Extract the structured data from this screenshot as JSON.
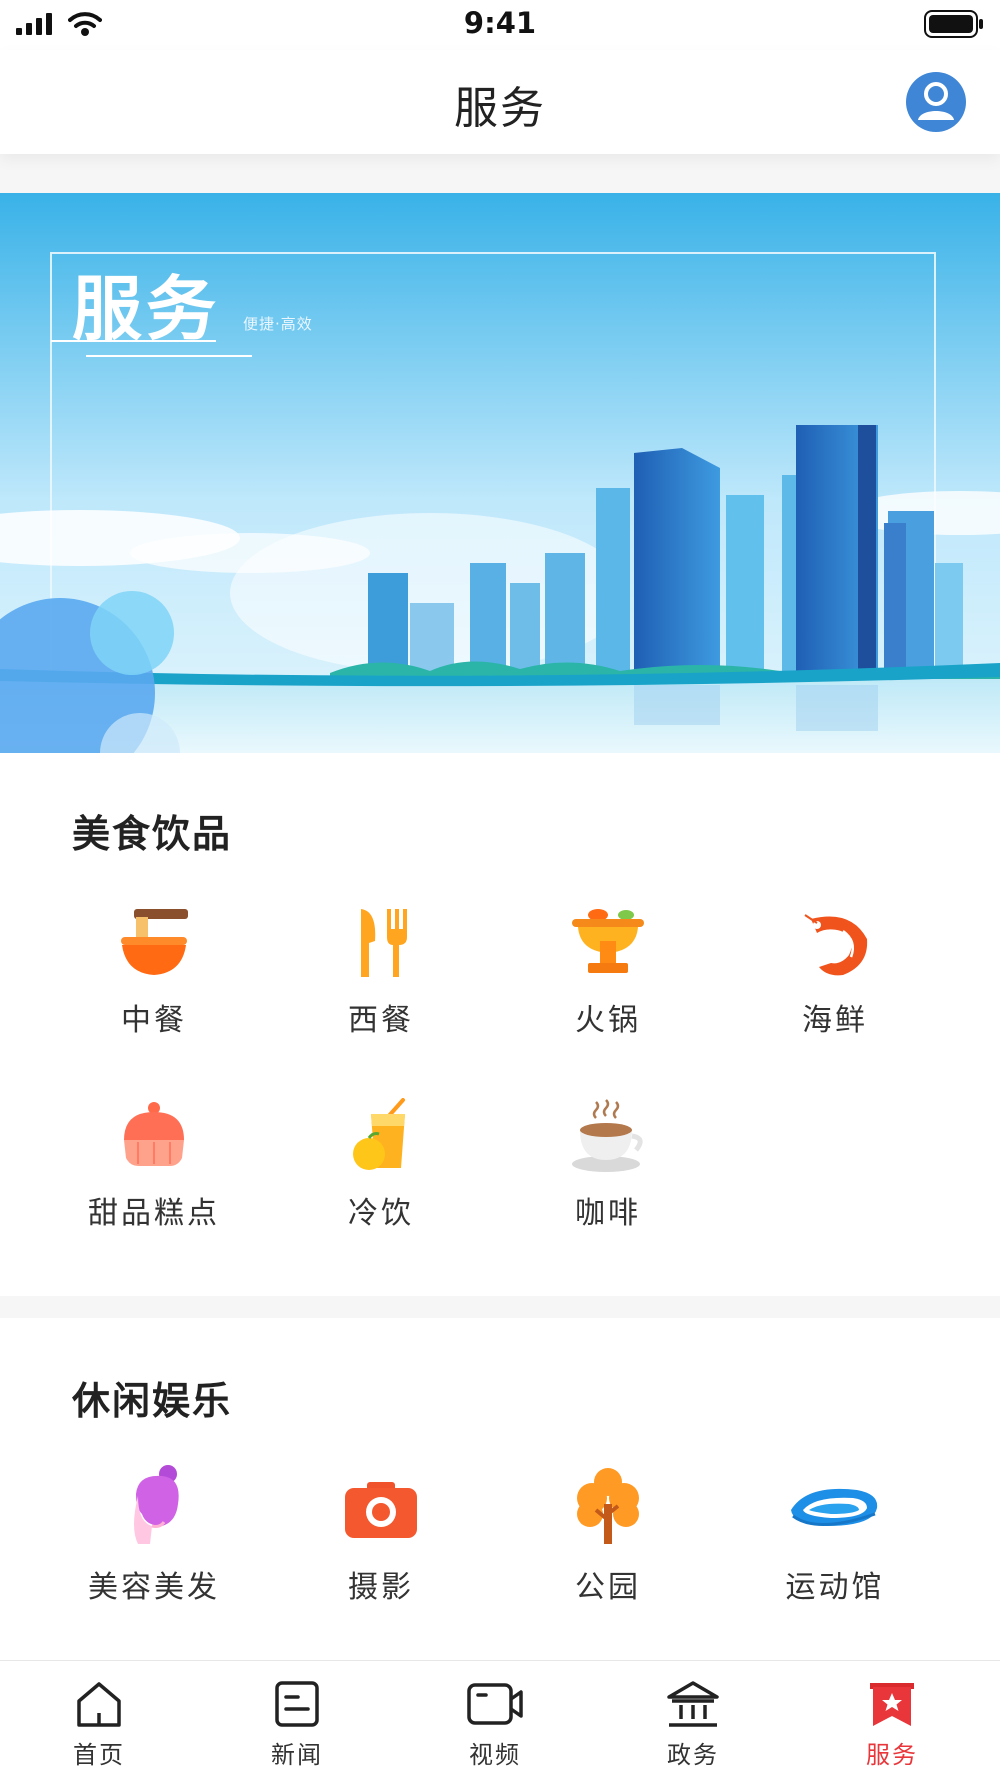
{
  "status_bar": {
    "time": "9:41"
  },
  "header": {
    "title": "服务"
  },
  "banner": {
    "title": "服务",
    "subtitle": "便捷·高效"
  },
  "sections": [
    {
      "title": "美食饮品",
      "items": [
        {
          "label": "中餐",
          "icon": "noodle-bowl-icon"
        },
        {
          "label": "西餐",
          "icon": "fork-knife-icon"
        },
        {
          "label": "火锅",
          "icon": "hotpot-icon"
        },
        {
          "label": "海鲜",
          "icon": "shrimp-icon"
        },
        {
          "label": "甜品糕点",
          "icon": "cake-icon"
        },
        {
          "label": "冷饮",
          "icon": "juice-icon"
        },
        {
          "label": "咖啡",
          "icon": "coffee-cup-icon"
        }
      ]
    },
    {
      "title": "休闲娱乐",
      "items": [
        {
          "label": "美容美发",
          "icon": "hair-salon-icon"
        },
        {
          "label": "摄影",
          "icon": "camera-icon"
        },
        {
          "label": "公园",
          "icon": "tree-icon"
        },
        {
          "label": "运动馆",
          "icon": "stadium-icon"
        }
      ]
    }
  ],
  "tabbar": {
    "active": "服务",
    "active_color": "#e8363a",
    "tabs": [
      {
        "label": "首页",
        "icon": "home-icon"
      },
      {
        "label": "新闻",
        "icon": "news-icon"
      },
      {
        "label": "视频",
        "icon": "video-camera-icon"
      },
      {
        "label": "政务",
        "icon": "government-building-icon"
      },
      {
        "label": "服务",
        "icon": "service-bookmark-icon"
      }
    ]
  }
}
